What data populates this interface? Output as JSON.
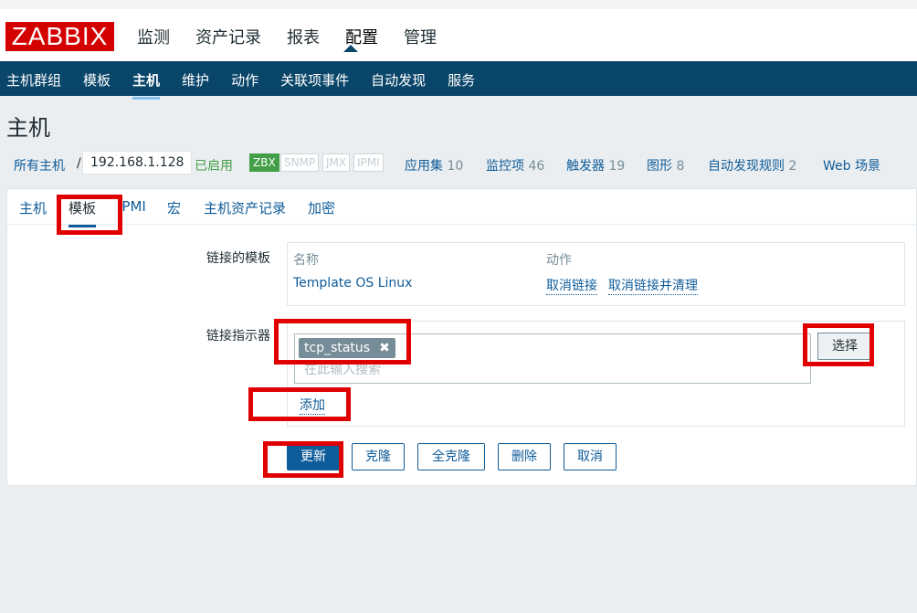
{
  "app": {
    "logo": "ZABBIX"
  },
  "main_nav": {
    "monitoring": "监测",
    "inventory": "资产记录",
    "reports": "报表",
    "configuration": "配置",
    "administration": "管理"
  },
  "sub_nav": {
    "host_groups": "主机群组",
    "templates": "模板",
    "hosts": "主机",
    "maintenance": "维护",
    "actions": "动作",
    "correlation": "关联项事件",
    "discovery": "自动发现",
    "services": "服务"
  },
  "page_title": "主机",
  "host_bar": {
    "all_hosts": "所有主机",
    "separator": "/",
    "host_name": "192.168.1.128",
    "status": "已启用",
    "tags": {
      "zbx": "ZBX",
      "snmp": "SNMP",
      "jmx": "JMX",
      "ipmi": "IPMI"
    },
    "applications": {
      "label": "应用集",
      "count": "10"
    },
    "items": {
      "label": "监控项",
      "count": "46"
    },
    "triggers": {
      "label": "触发器",
      "count": "19"
    },
    "graphs": {
      "label": "图形",
      "count": "8"
    },
    "discovery_rules": {
      "label": "自动发现规则",
      "count": "2"
    },
    "web_scenarios": {
      "label": "Web 场景"
    }
  },
  "tabs": {
    "host": "主机",
    "templates": "模板",
    "ipmi": "IPMI",
    "macros": "宏",
    "inventory": "主机资产记录",
    "encryption": "加密"
  },
  "linked_templates": {
    "label": "链接的模板",
    "col_name": "名称",
    "col_action": "动作",
    "template_name": "Template OS Linux",
    "unlink": "取消链接",
    "unlink_clear": "取消链接并清理"
  },
  "link_new": {
    "label": "链接指示器",
    "chip": "tcp_status",
    "placeholder": "在此输入搜索",
    "select": "选择",
    "add": "添加"
  },
  "buttons": {
    "update": "更新",
    "clone": "克隆",
    "full_clone": "全克隆",
    "delete": "删除",
    "cancel": "取消"
  },
  "colors": {
    "brand": "#d40000",
    "nav": "#0a466a",
    "link": "#0f5c9a",
    "enabled": "#429e47",
    "highlight": "#e00000"
  }
}
